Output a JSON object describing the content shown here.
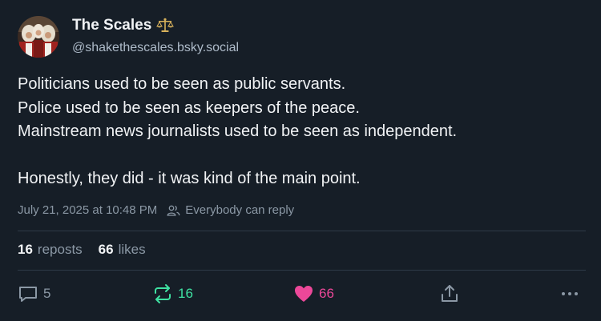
{
  "author": {
    "display_name": "The Scales",
    "name_icon": "scales-icon",
    "handle": "@shakethescales.bsky.social",
    "avatar": "avatar"
  },
  "post": {
    "lines": [
      "Politicians used to be seen as public servants.",
      "Police used to be seen as keepers of the peace.",
      "Mainstream news journalists used to be seen as independent.",
      "",
      "Honestly, they did - it was kind of the main point."
    ],
    "timestamp": "July 21, 2025 at 10:48 PM",
    "reply_setting": "Everybody can reply"
  },
  "stats": {
    "reposts_count": "16",
    "reposts_label": "reposts",
    "likes_count": "66",
    "likes_label": "likes"
  },
  "actions": {
    "reply_count": "5",
    "repost_count": "16",
    "like_count": "66"
  },
  "colors": {
    "background": "#161e27",
    "repost_active": "#3fe2a2",
    "like_active": "#ec4899",
    "muted": "#8b98a5"
  }
}
